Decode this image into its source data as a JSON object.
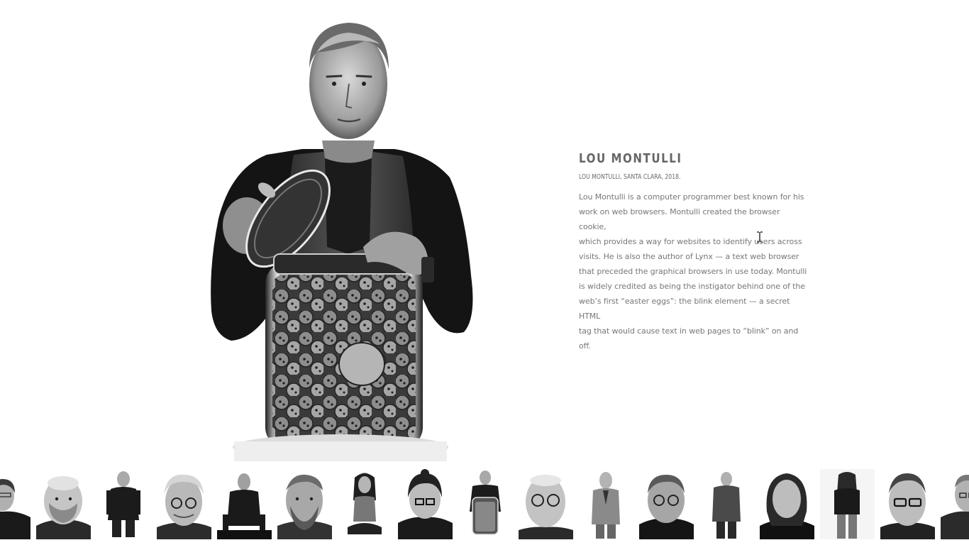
{
  "profile": {
    "name": "LOU MONTULLI",
    "caption": "LOU MONTULLI, SANTA CLARA, 2018.",
    "bio_lines": [
      "Lou Montulli is a computer programmer best known for his",
      "work on web browsers. Montulli created the browser cookie,",
      "which provides a way for websites to identify users across",
      "visits. He is also the author of Lynx — a text web browser",
      "that preceded the graphical browsers in use today. Montulli",
      "is widely credited as being the instigator behind one of the",
      "web’s first “easter eggs”: the blink element — a secret HTML",
      "tag that would cause text in web pages to “blink” on and off."
    ]
  },
  "hero": {
    "icon": "portrait-with-cookie-jar"
  },
  "thumbnails": [
    {
      "icon": "portrait-thumbnail"
    },
    {
      "icon": "portrait-thumbnail"
    },
    {
      "icon": "portrait-thumbnail"
    },
    {
      "icon": "portrait-thumbnail"
    },
    {
      "icon": "portrait-thumbnail"
    },
    {
      "icon": "portrait-thumbnail"
    },
    {
      "icon": "portrait-thumbnail"
    },
    {
      "icon": "portrait-thumbnail"
    },
    {
      "icon": "portrait-thumbnail"
    },
    {
      "icon": "portrait-thumbnail"
    },
    {
      "icon": "portrait-thumbnail"
    },
    {
      "icon": "portrait-thumbnail"
    },
    {
      "icon": "portrait-thumbnail"
    },
    {
      "icon": "portrait-thumbnail"
    },
    {
      "icon": "portrait-thumbnail"
    },
    {
      "icon": "portrait-thumbnail"
    },
    {
      "icon": "portrait-thumbnail"
    }
  ],
  "colors": {
    "background": "#ffffff",
    "text": "#777777",
    "heading": "#666666"
  }
}
